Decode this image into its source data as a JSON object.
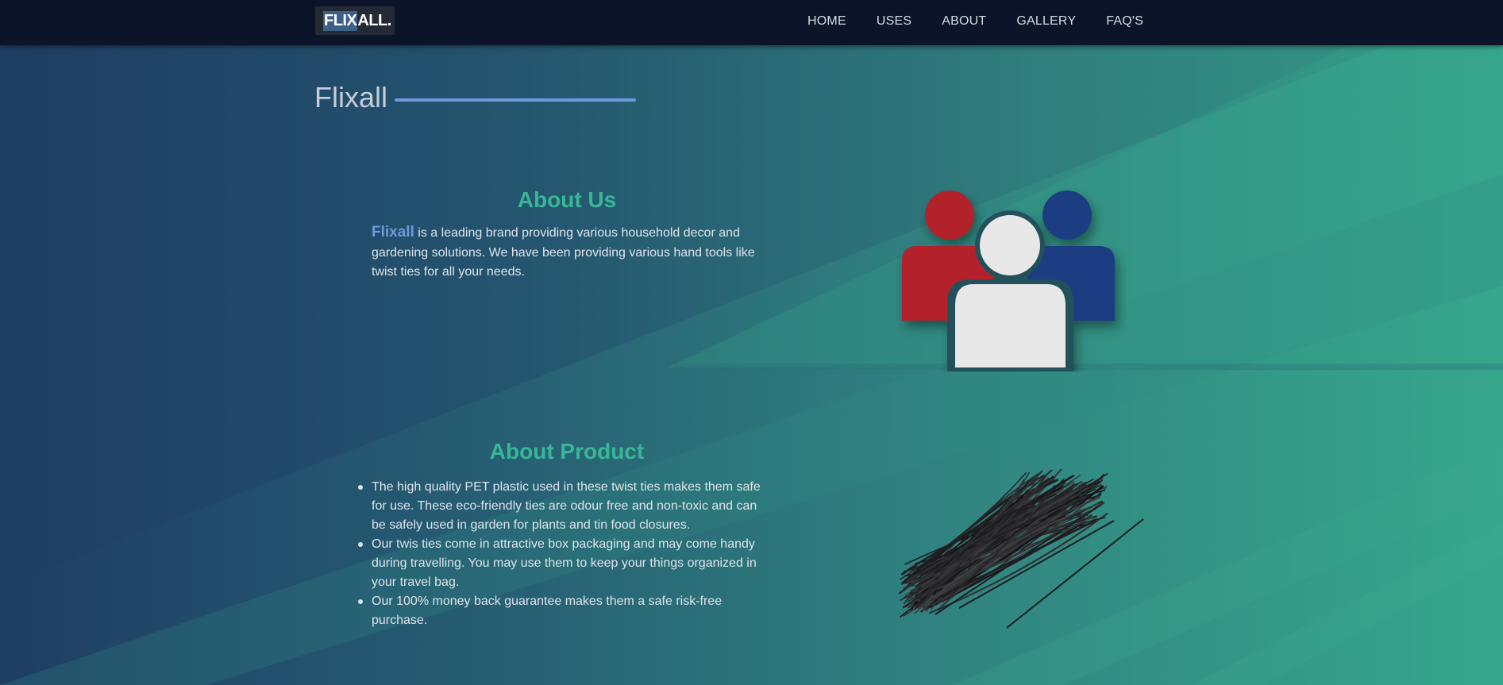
{
  "navbar": {
    "logo": {
      "part1": "FLIX",
      "part2": "ALL."
    },
    "links": [
      "HOME",
      "USES",
      "ABOUT",
      "GALLERY",
      "FAQ'S"
    ]
  },
  "page_title": "Flixall",
  "about": {
    "heading": "About Us",
    "brand": "Flixall",
    "text": " is a leading brand providing various household decor and gardening solutions. We have been providing various hand tools like twist ties for all your needs."
  },
  "product": {
    "heading": "About Product",
    "items": [
      "The high quality PET plastic used in these twist ties makes them safe for use. These eco-friendly ties are odour free and non-toxic and can be safely used in garden for plants and tin food closures.",
      "Our twis ties come in attractive box packaging and may come handy during travelling. You may use them to keep your things organized in your travel bag.",
      "Our 100% money back guarantee makes them a safe risk-free purchase."
    ]
  },
  "colors": {
    "navbar_bg": "#0b1428",
    "accent_blue": "#6f98df",
    "heading_green": "#38b796",
    "person_red": "#b3232a",
    "person_blue": "#1e3c82",
    "person_white": "#e8e8e8"
  },
  "icons": {
    "people": "people-group-icon",
    "ties": "twist-ties-image"
  }
}
